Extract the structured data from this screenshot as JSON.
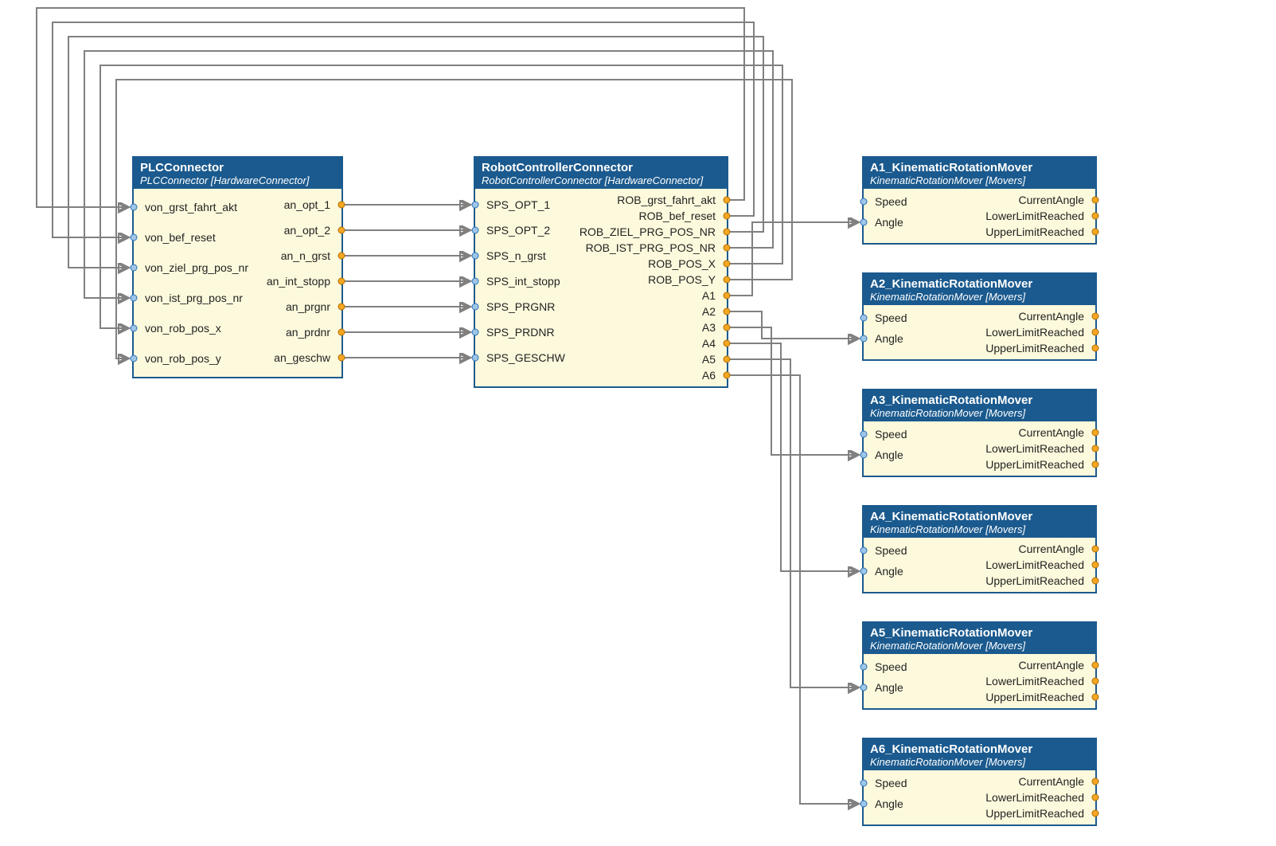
{
  "nodes": {
    "plc": {
      "title": "PLCConnector",
      "subtitle": "PLCConnector [HardwareConnector]",
      "inputs": [
        "von_grst_fahrt_akt",
        "von_bef_reset",
        "von_ziel_prg_pos_nr",
        "von_ist_prg_pos_nr",
        "von_rob_pos_x",
        "von_rob_pos_y"
      ],
      "outputs": [
        "an_opt_1",
        "an_opt_2",
        "an_n_grst",
        "an_int_stopp",
        "an_prgnr",
        "an_prdnr",
        "an_geschw"
      ]
    },
    "robot": {
      "title": "RobotControllerConnector",
      "subtitle": "RobotControllerConnector [HardwareConnector]",
      "inputs": [
        "SPS_OPT_1",
        "SPS_OPT_2",
        "SPS_n_grst",
        "SPS_int_stopp",
        "SPS_PRGNR",
        "SPS_PRDNR",
        "SPS_GESCHW"
      ],
      "outputs": [
        "ROB_grst_fahrt_akt",
        "ROB_bef_reset",
        "ROB_ZIEL_PRG_POS_NR",
        "ROB_IST_PRG_POS_NR",
        "ROB_POS_X",
        "ROB_POS_Y",
        "A1",
        "A2",
        "A3",
        "A4",
        "A5",
        "A6"
      ]
    },
    "movers": [
      {
        "title": "A1_KinematicRotationMover",
        "subtitle": "KinematicRotationMover [Movers]",
        "inputs": [
          "Speed",
          "Angle"
        ],
        "outputs": [
          "CurrentAngle",
          "LowerLimitReached",
          "UpperLimitReached"
        ]
      },
      {
        "title": "A2_KinematicRotationMover",
        "subtitle": "KinematicRotationMover [Movers]",
        "inputs": [
          "Speed",
          "Angle"
        ],
        "outputs": [
          "CurrentAngle",
          "LowerLimitReached",
          "UpperLimitReached"
        ]
      },
      {
        "title": "A3_KinematicRotationMover",
        "subtitle": "KinematicRotationMover [Movers]",
        "inputs": [
          "Speed",
          "Angle"
        ],
        "outputs": [
          "CurrentAngle",
          "LowerLimitReached",
          "UpperLimitReached"
        ]
      },
      {
        "title": "A4_KinematicRotationMover",
        "subtitle": "KinematicRotationMover [Movers]",
        "inputs": [
          "Speed",
          "Angle"
        ],
        "outputs": [
          "CurrentAngle",
          "LowerLimitReached",
          "UpperLimitReached"
        ]
      },
      {
        "title": "A5_KinematicRotationMover",
        "subtitle": "KinematicRotationMover [Movers]",
        "inputs": [
          "Speed",
          "Angle"
        ],
        "outputs": [
          "CurrentAngle",
          "LowerLimitReached",
          "UpperLimitReached"
        ]
      },
      {
        "title": "A6_KinematicRotationMover",
        "subtitle": "KinematicRotationMover [Movers]",
        "inputs": [
          "Speed",
          "Angle"
        ],
        "outputs": [
          "CurrentAngle",
          "LowerLimitReached",
          "UpperLimitReached"
        ]
      }
    ]
  },
  "wires": {
    "plc_to_robot": [
      {
        "from": "an_opt_1",
        "to": "SPS_OPT_1"
      },
      {
        "from": "an_opt_2",
        "to": "SPS_OPT_2"
      },
      {
        "from": "an_n_grst",
        "to": "SPS_n_grst"
      },
      {
        "from": "an_int_stopp",
        "to": "SPS_int_stopp"
      },
      {
        "from": "an_prgnr",
        "to": "SPS_PRGNR"
      },
      {
        "from": "an_prdnr",
        "to": "SPS_PRDNR"
      },
      {
        "from": "an_geschw",
        "to": "SPS_GESCHW"
      }
    ],
    "robot_feedback_to_plc": [
      {
        "from": "ROB_grst_fahrt_akt",
        "to": "von_grst_fahrt_akt"
      },
      {
        "from": "ROB_bef_reset",
        "to": "von_bef_reset"
      },
      {
        "from": "ROB_ZIEL_PRG_POS_NR",
        "to": "von_ziel_prg_pos_nr"
      },
      {
        "from": "ROB_IST_PRG_POS_NR",
        "to": "von_ist_prg_pos_nr"
      },
      {
        "from": "ROB_POS_X",
        "to": "von_rob_pos_x"
      },
      {
        "from": "ROB_POS_Y",
        "to": "von_rob_pos_y"
      }
    ],
    "robot_axes_to_movers": [
      {
        "from": "A1",
        "to": "A1_KinematicRotationMover.Angle"
      },
      {
        "from": "A2",
        "to": "A2_KinematicRotationMover.Angle"
      },
      {
        "from": "A3",
        "to": "A3_KinematicRotationMover.Angle"
      },
      {
        "from": "A4",
        "to": "A4_KinematicRotationMover.Angle"
      },
      {
        "from": "A5",
        "to": "A5_KinematicRotationMover.Angle"
      },
      {
        "from": "A6",
        "to": "A6_KinematicRotationMover.Angle"
      }
    ]
  },
  "colors": {
    "header_bg": "#1b5a8e",
    "body_bg": "#fdf9dc",
    "wire": "#808080",
    "input_port": "#9fc5e8",
    "output_port": "#f5a623"
  }
}
